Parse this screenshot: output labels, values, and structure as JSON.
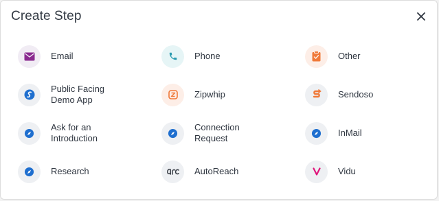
{
  "dialog": {
    "title": "Create Step",
    "close_icon": "close-icon"
  },
  "options": [
    {
      "label": "Email",
      "icon": "envelope-icon"
    },
    {
      "label": "Phone",
      "icon": "phone-icon"
    },
    {
      "label": "Other",
      "icon": "clipboard-check-icon"
    },
    {
      "label": "Public Facing\nDemo App",
      "icon": "demo-app-logo-icon"
    },
    {
      "label": "Zipwhip",
      "icon": "zipwhip-logo-icon"
    },
    {
      "label": "Sendoso",
      "icon": "sendoso-logo-icon"
    },
    {
      "label": "Ask for an\nIntroduction",
      "icon": "compass-icon"
    },
    {
      "label": "Connection\nRequest",
      "icon": "compass-icon"
    },
    {
      "label": "InMail",
      "icon": "compass-icon"
    },
    {
      "label": "Research",
      "icon": "compass-icon"
    },
    {
      "label": "AutoReach",
      "icon": "autoreach-logo-icon"
    },
    {
      "label": "Vidu",
      "icon": "vidu-logo-icon"
    }
  ],
  "colors": {
    "email": "#8a2a8f",
    "phone": "#2a9bb0",
    "orange": "#f07a3a",
    "compass": "#1f6fcf",
    "vidu": "#e0147a"
  }
}
